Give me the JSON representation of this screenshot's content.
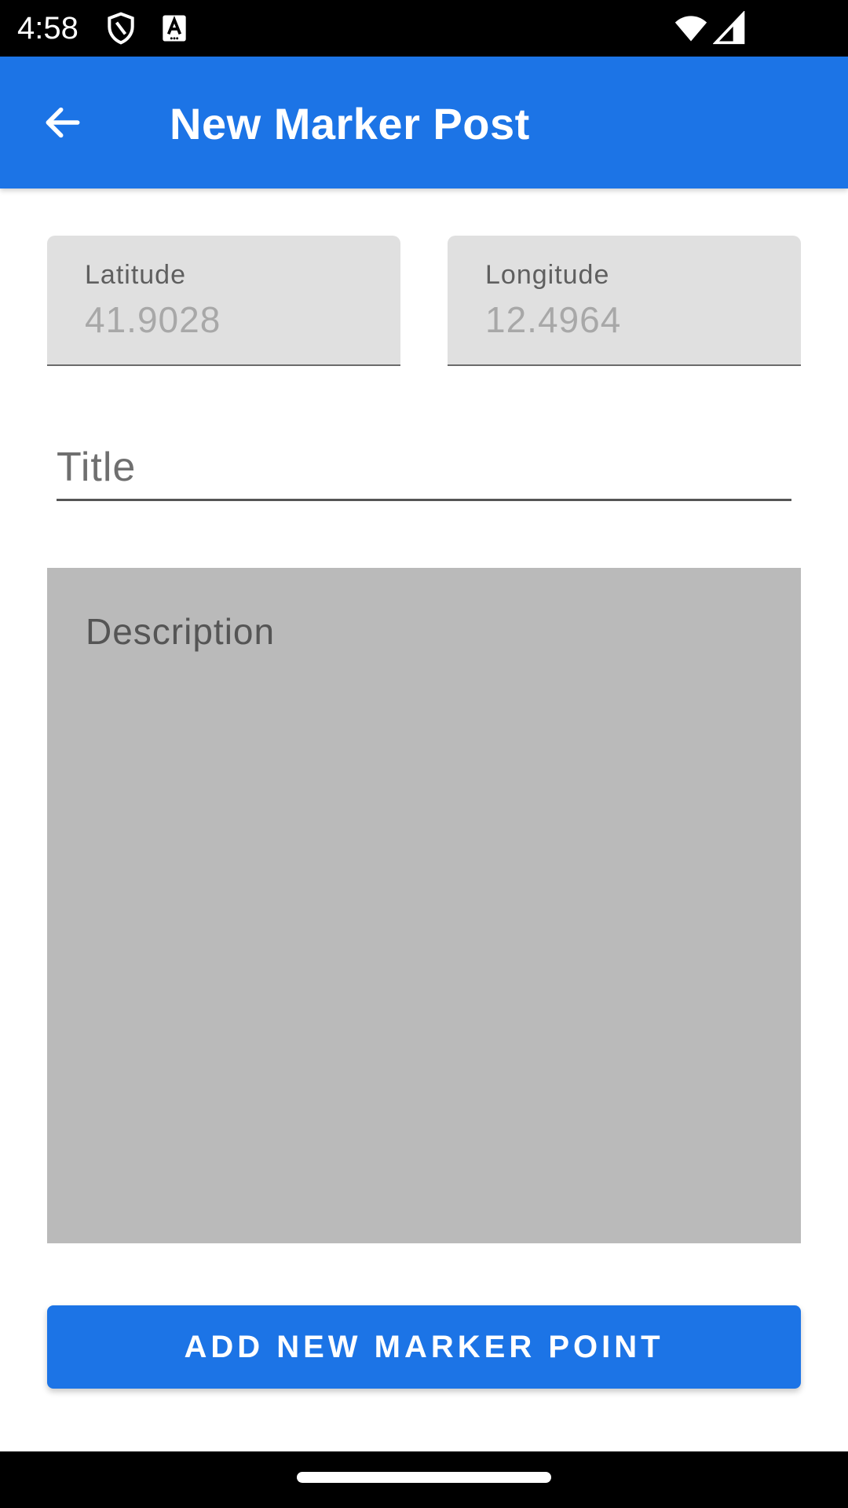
{
  "status_bar": {
    "time": "4:58",
    "icons": [
      "shield-icon",
      "a-badge-icon",
      "wifi-icon",
      "cellular-signal-icon"
    ]
  },
  "app_bar": {
    "back_icon": "arrow-left-icon",
    "title": "New Marker Post",
    "color": "#1c74e6"
  },
  "form": {
    "latitude": {
      "label": "Latitude",
      "value": "41.9028"
    },
    "longitude": {
      "label": "Longitude",
      "value": "12.4964"
    },
    "title": {
      "placeholder": "Title",
      "value": ""
    },
    "description": {
      "placeholder": "Description",
      "value": ""
    }
  },
  "actions": {
    "submit_label": "ADD NEW MARKER POINT"
  },
  "colors": {
    "primary": "#1c74e6",
    "field_fill": "#e0e0e0",
    "description_fill": "#bababa"
  }
}
